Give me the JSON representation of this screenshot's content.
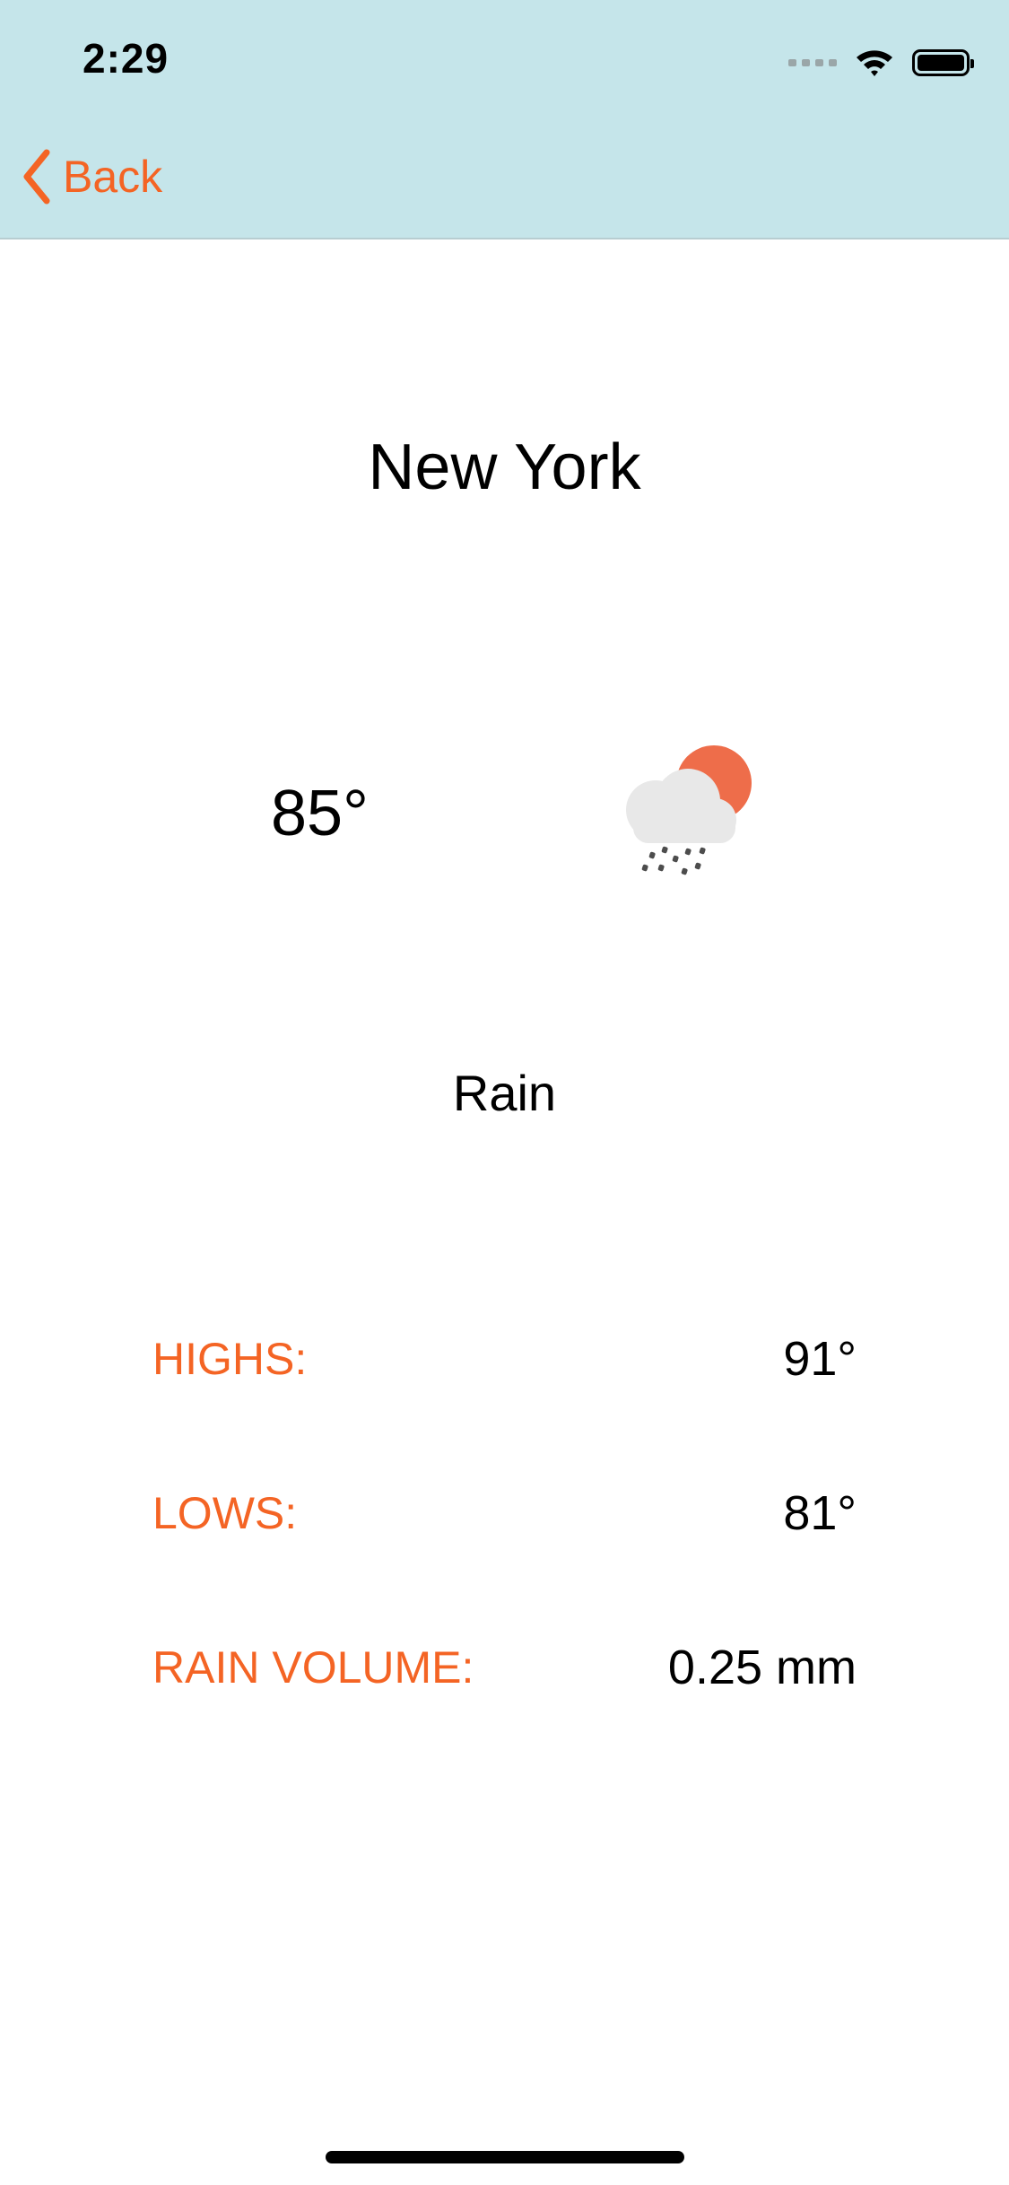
{
  "status_bar": {
    "time": "2:29",
    "icons": [
      "cellular-signal-icon",
      "wifi-icon",
      "battery-icon"
    ]
  },
  "nav": {
    "back_label": "Back",
    "back_icon": "chevron-left-icon"
  },
  "weather": {
    "city": "New York",
    "temperature": "85°",
    "condition": "Rain",
    "icon": "rain-cloud-sun-icon"
  },
  "stats": {
    "highs": {
      "label": "HIGHS:",
      "value": "91°"
    },
    "lows": {
      "label": "LOWS:",
      "value": "81°"
    },
    "rain_volume": {
      "label": "RAIN VOLUME:",
      "value": "0.25 mm"
    }
  },
  "colors": {
    "accent": "#f46424",
    "header_background": "#c5e5ea",
    "sun": "#ee6d4a",
    "cloud": "#e8e8e8",
    "rain": "#4d4d4d"
  }
}
